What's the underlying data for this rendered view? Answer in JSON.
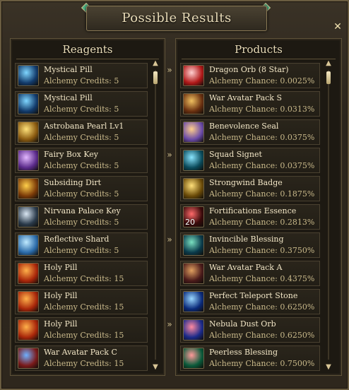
{
  "window": {
    "title": "Possible Results",
    "close_icon": "close-icon"
  },
  "reagents": {
    "header": "Reagents",
    "items": [
      {
        "name": "Mystical Pill",
        "sub": "Alchemy Credits:   5",
        "icon": "blue-swirl-icon",
        "c1": "#7fd6ff",
        "c2": "#123a6a"
      },
      {
        "name": "Mystical Pill",
        "sub": "Alchemy Credits:   5",
        "icon": "blue-swirl-icon",
        "c1": "#7fd6ff",
        "c2": "#123a6a"
      },
      {
        "name": "Astrobana Pearl Lv1",
        "sub": "Alchemy Credits:   5",
        "icon": "golden-pearl-icon",
        "c1": "#ffe27a",
        "c2": "#8a5a10"
      },
      {
        "name": "Fairy Box Key",
        "sub": "Alchemy Credits:   5",
        "icon": "purple-key-icon",
        "c1": "#e3b8ff",
        "c2": "#5a2a8a"
      },
      {
        "name": "Subsiding Dirt",
        "sub": "Alchemy Credits:   5",
        "icon": "flame-dirt-icon",
        "c1": "#ffcf4a",
        "c2": "#7a3a08"
      },
      {
        "name": "Nirvana Palace Key",
        "sub": "Alchemy Credits:   5",
        "icon": "silver-key-icon",
        "c1": "#d9e6f2",
        "c2": "#2a3a4a"
      },
      {
        "name": "Reflective Shard",
        "sub": "Alchemy Credits:   5",
        "icon": "crystal-shard-icon",
        "c1": "#bfeaff",
        "c2": "#2a6aa8"
      },
      {
        "name": "Holy Pill",
        "sub": "Alchemy Credits:   15",
        "icon": "orange-orb-icon",
        "c1": "#ffb04a",
        "c2": "#a8260a"
      },
      {
        "name": "Holy Pill",
        "sub": "Alchemy Credits:   15",
        "icon": "orange-orb-icon",
        "c1": "#ffb04a",
        "c2": "#a8260a"
      },
      {
        "name": "Holy Pill",
        "sub": "Alchemy Credits:   15",
        "icon": "orange-orb-icon",
        "c1": "#ffb04a",
        "c2": "#a8260a"
      },
      {
        "name": "War Avatar Pack C",
        "sub": "Alchemy Credits:   15",
        "icon": "war-avatar-icon",
        "c1": "#6fb0ff",
        "c2": "#7a1a1a"
      }
    ]
  },
  "products": {
    "header": "Products",
    "items": [
      {
        "name": "Dragon Orb (8 Star)",
        "sub": "Alchemy Chance: 0.0025%",
        "icon": "red-orb-icon",
        "c1": "#ffd0d0",
        "c2": "#b01818",
        "qty": ""
      },
      {
        "name": "War Avatar Pack S",
        "sub": "Alchemy Chance: 0.0313%",
        "icon": "treasure-chest-icon",
        "c1": "#f0c060",
        "c2": "#6a3010",
        "qty": ""
      },
      {
        "name": "Benevolence Seal",
        "sub": "Alchemy Chance: 0.0375%",
        "icon": "seal-scroll-icon",
        "c1": "#ffcf8a",
        "c2": "#6a4aa8",
        "qty": ""
      },
      {
        "name": "Squad Signet",
        "sub": "Alchemy Chance: 0.0375%",
        "icon": "signet-icon",
        "c1": "#8ae6ff",
        "c2": "#0a4a5a",
        "qty": ""
      },
      {
        "name": "Strongwind Badge",
        "sub": "Alchemy Chance: 0.1875%",
        "icon": "gold-badge-icon",
        "c1": "#ffe07a",
        "c2": "#6a4a08",
        "qty": ""
      },
      {
        "name": "Fortifications Essence",
        "sub": "Alchemy Chance: 0.2813%",
        "icon": "essence-jar-icon",
        "c1": "#ff6a6a",
        "c2": "#3a0a0a",
        "qty": "20"
      },
      {
        "name": "Invincible Blessing",
        "sub": "Alchemy Chance: 0.3750%",
        "icon": "blessing-pouch-icon",
        "c1": "#7ae0c0",
        "c2": "#0a3a4a",
        "qty": ""
      },
      {
        "name": "War Avatar Pack A",
        "sub": "Alchemy Chance: 0.4375%",
        "icon": "treasure-chest-icon",
        "c1": "#e0a060",
        "c2": "#4a1a1a",
        "qty": ""
      },
      {
        "name": "Perfect Teleport Stone",
        "sub": "Alchemy Chance: 0.6250%",
        "icon": "teleport-stone-icon",
        "c1": "#9ad8ff",
        "c2": "#0a2a7a",
        "qty": ""
      },
      {
        "name": "Nebula Dust Orb",
        "sub": "Alchemy Chance: 0.6250%",
        "icon": "nebula-orb-icon",
        "c1": "#ff8aa0",
        "c2": "#1a2a8a",
        "qty": ""
      },
      {
        "name": "Peerless Blessing",
        "sub": "Alchemy Chance: 0.7500%",
        "icon": "blessing-pouch-icon",
        "c1": "#ff9a9a",
        "c2": "#0a5a3a",
        "qty": ""
      }
    ]
  },
  "separator": "»"
}
